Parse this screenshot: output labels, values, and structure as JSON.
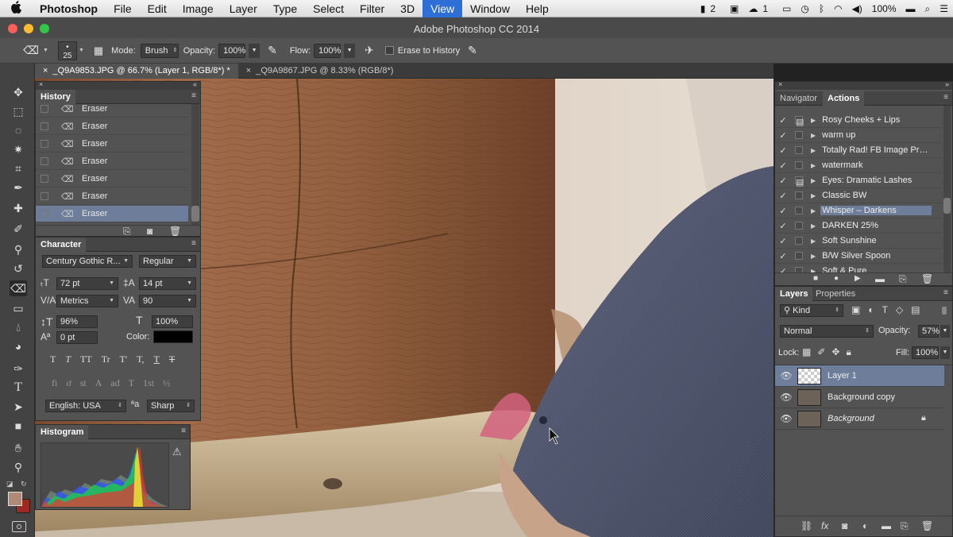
{
  "menubar": {
    "apple": "",
    "items": [
      "Photoshop",
      "File",
      "Edit",
      "Image",
      "Layer",
      "Type",
      "Select",
      "Filter",
      "3D",
      "View",
      "Window",
      "Help"
    ],
    "active_index": 9,
    "status": {
      "badge_count": "2",
      "cc_count": "1",
      "battery": "100%"
    }
  },
  "window": {
    "title": "Adobe Photoshop CC 2014"
  },
  "options": {
    "brush_size": "25",
    "mode_label": "Mode:",
    "mode_value": "Brush",
    "opacity_label": "Opacity:",
    "opacity_value": "100%",
    "flow_label": "Flow:",
    "flow_value": "100%",
    "erase_history_label": "Erase to History"
  },
  "doc_tabs": [
    {
      "label": "_Q9A9853.JPG @ 66.7% (Layer 1, RGB/8*) *",
      "active": true
    },
    {
      "label": "_Q9A9867.JPG @ 8.33% (RGB/8*)",
      "active": false
    }
  ],
  "history": {
    "tab": "History",
    "items": [
      "Eraser",
      "Eraser",
      "Eraser",
      "Eraser",
      "Eraser",
      "Eraser",
      "Eraser"
    ],
    "selected_index": 6
  },
  "character": {
    "tab": "Character",
    "font_family": "Century Gothic R...",
    "font_style": "Regular",
    "font_size": "72 pt",
    "leading": "14 pt",
    "kerning": "Metrics",
    "tracking": "90",
    "vertical_scale": "96%",
    "horizontal_scale": "100%",
    "baseline_shift": "0 pt",
    "color_label": "Color:",
    "color_value": "#000000",
    "language": "English: USA",
    "aa_label": "a",
    "antialias": "Sharp",
    "style_buttons": [
      "T",
      "T",
      "TT",
      "Tr",
      "T'",
      "T,",
      "T",
      "T"
    ],
    "opentype_buttons": [
      "fi",
      "ơ",
      "st",
      "A",
      "ad",
      "T",
      "1st",
      "½"
    ]
  },
  "histogram": {
    "tab": "Histogram",
    "warning": "⚠"
  },
  "navigator_actions": {
    "tabs": [
      "Navigator",
      "Actions"
    ],
    "active_tab": "Actions",
    "actions": [
      {
        "name": "Rosy Cheeks + Lips",
        "dialog": true
      },
      {
        "name": "warm up",
        "dialog": false
      },
      {
        "name": "Totally Rad! FB Image Prep...",
        "dialog": false
      },
      {
        "name": "watermark",
        "dialog": false
      },
      {
        "name": "Eyes: Dramatic Lashes",
        "dialog": true
      },
      {
        "name": "Classic BW",
        "dialog": false
      },
      {
        "name": "Whisper – Darkens",
        "dialog": false
      },
      {
        "name": "DARKEN 25%",
        "dialog": false
      },
      {
        "name": "Soft Sunshine",
        "dialog": false
      },
      {
        "name": "B/W Silver Spoon",
        "dialog": false
      },
      {
        "name": "Soft & Pure",
        "dialog": false
      }
    ],
    "selected_index": 6
  },
  "layers": {
    "tabs": [
      "Layers",
      "Properties"
    ],
    "kind_filter": "Kind",
    "blend_mode": "Normal",
    "opacity_label": "Opacity:",
    "opacity_value": "57%",
    "lock_label": "Lock:",
    "fill_label": "Fill:",
    "fill_value": "100%",
    "items": [
      {
        "name": "Layer 1",
        "selected": true,
        "locked": false
      },
      {
        "name": "Background copy",
        "selected": false,
        "locked": false
      },
      {
        "name": "Background",
        "selected": false,
        "locked": true
      }
    ]
  },
  "colors": {
    "accent": "#2d6fd6",
    "selection": "#6d7d9a",
    "fg_swatch": "#b08a76",
    "bg_swatch": "#9c2a22"
  }
}
